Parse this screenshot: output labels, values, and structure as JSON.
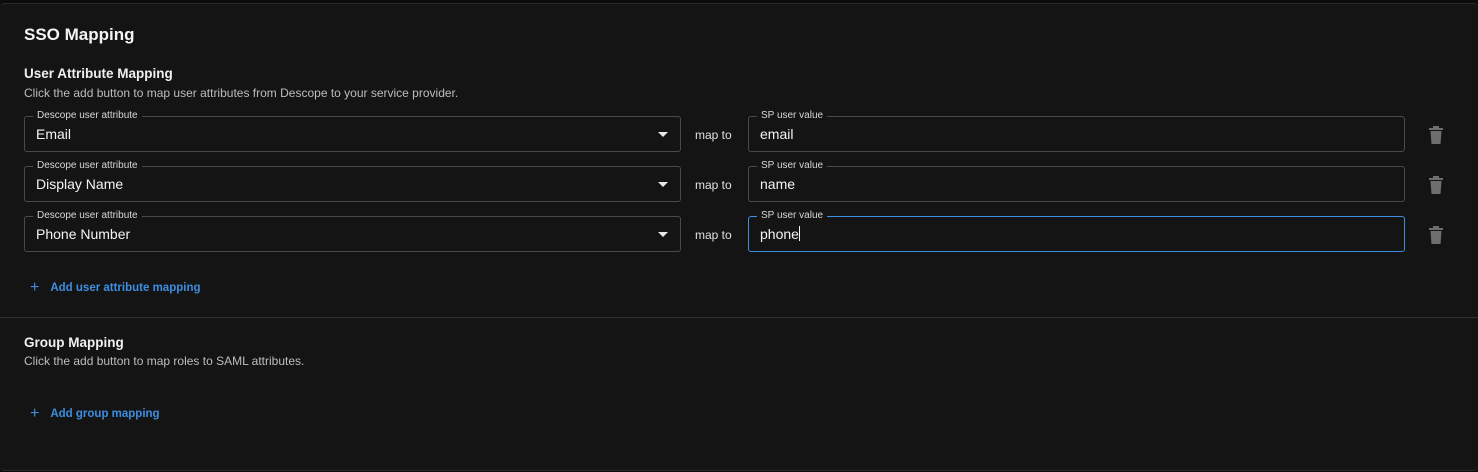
{
  "title": "SSO Mapping",
  "user_attr": {
    "title": "User Attribute Mapping",
    "description": "Click the add button to map user attributes from Descope to your service provider.",
    "rows": [
      {
        "attr_label": "Descope user attribute",
        "attr_value": "Email",
        "map_to": "map to",
        "sp_label": "SP user value",
        "sp_value": "email"
      },
      {
        "attr_label": "Descope user attribute",
        "attr_value": "Display Name",
        "map_to": "map to",
        "sp_label": "SP user value",
        "sp_value": "name"
      },
      {
        "attr_label": "Descope user attribute",
        "attr_value": "Phone Number",
        "map_to": "map to",
        "sp_label": "SP user value",
        "sp_value": "phone"
      }
    ],
    "add_label": "Add user attribute mapping"
  },
  "group": {
    "title": "Group Mapping",
    "description": "Click the add button to map roles to SAML attributes.",
    "add_label": "Add group mapping"
  },
  "colors": {
    "accent": "#3d8ee0",
    "background": "#141414"
  },
  "icons": [
    "chevron-down-icon",
    "trash-icon",
    "plus-icon"
  ]
}
